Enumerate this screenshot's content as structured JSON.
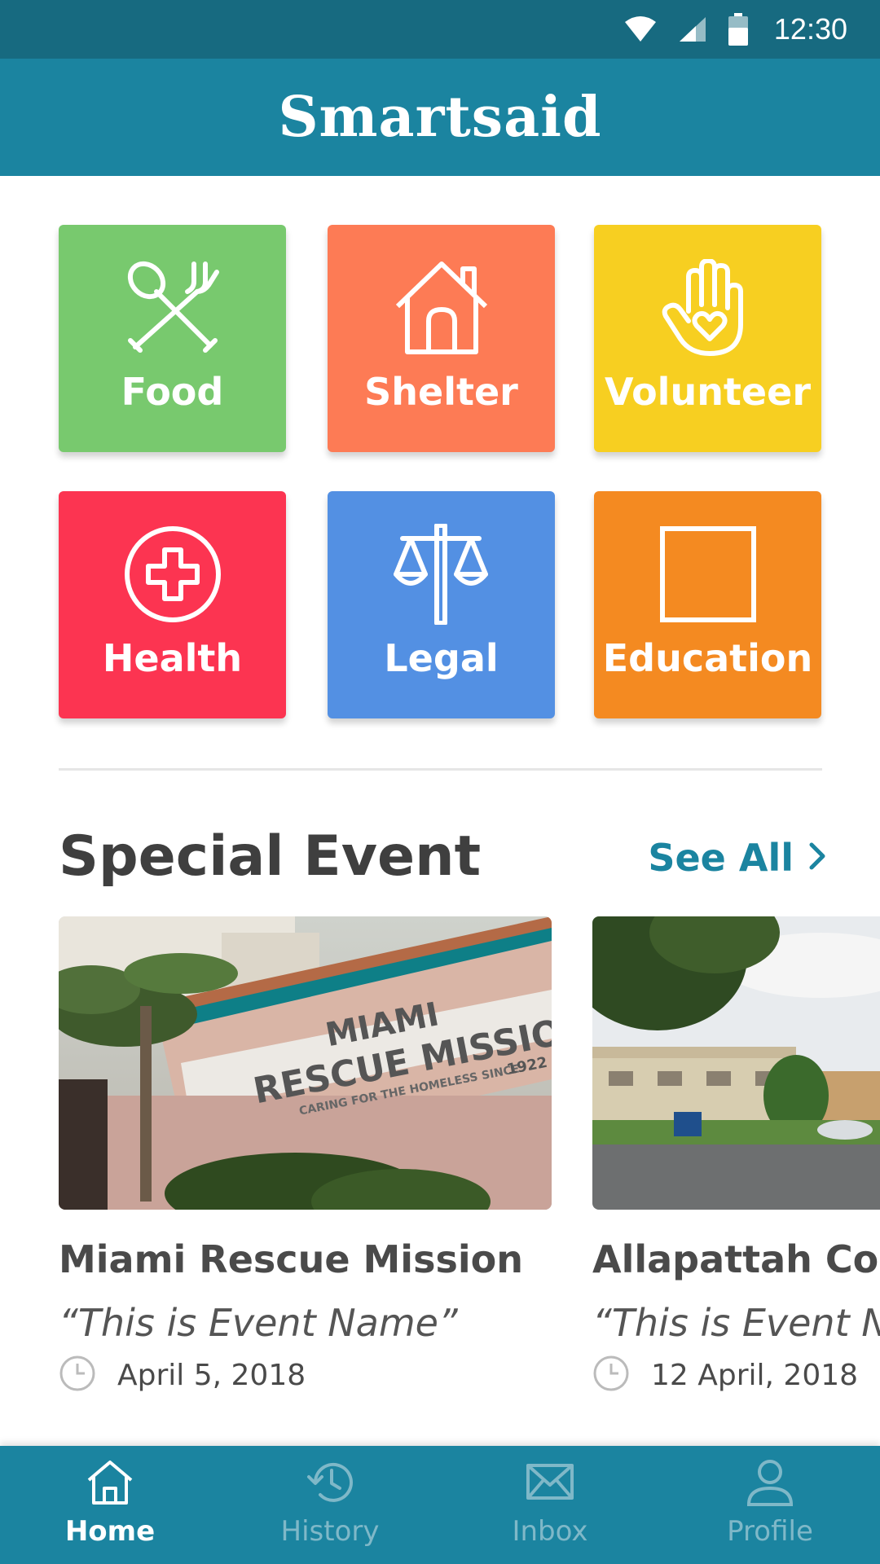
{
  "status_bar": {
    "time": "12:30"
  },
  "app_bar": {
    "title": "Smartsaid"
  },
  "categories": [
    {
      "label": "Food",
      "icon": "fork-spoon-icon",
      "color": "#78c96e"
    },
    {
      "label": "Shelter",
      "icon": "house-icon",
      "color": "#fd7b55"
    },
    {
      "label": "Volunteer",
      "icon": "hand-heart-icon",
      "color": "#f7cf21"
    },
    {
      "label": "Health",
      "icon": "medical-cross-icon",
      "color": "#fc3451"
    },
    {
      "label": "Legal",
      "icon": "scales-icon",
      "color": "#5390e3"
    },
    {
      "label": "Education",
      "icon": "square-icon",
      "color": "#f48a21"
    }
  ],
  "special_event": {
    "title": "Special Event",
    "see_all": "See All",
    "events": [
      {
        "name": "Miami Rescue Mission",
        "subtitle": "“This is Event Name”",
        "date": "April 5, 2018",
        "sign_text": [
          "MIAMI",
          "RESCUE MISSION",
          "CARING FOR THE HOMELESS SINCE",
          "1922"
        ]
      },
      {
        "name": "Allapattah Comm",
        "subtitle": "“This is Event Nam",
        "date": "12 April, 2018"
      }
    ]
  },
  "bottom_nav": {
    "items": [
      {
        "label": "Home",
        "icon": "home-icon",
        "active": true
      },
      {
        "label": "History",
        "icon": "history-icon",
        "active": false
      },
      {
        "label": "Inbox",
        "icon": "mail-icon",
        "active": false
      },
      {
        "label": "Profile",
        "icon": "person-icon",
        "active": false
      }
    ]
  },
  "colors": {
    "status_bar": "#176a80",
    "app_bar": "#1b84a0",
    "accent": "#1b84a0",
    "nav_inactive": "#7fb8c8"
  }
}
